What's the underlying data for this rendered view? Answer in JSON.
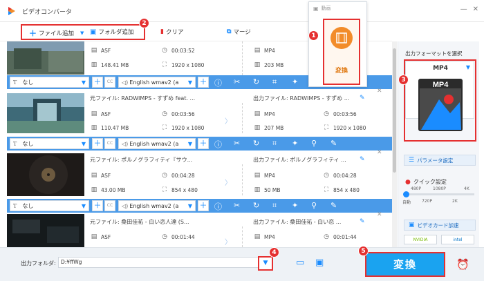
{
  "app": {
    "title": "ビデオコンバータ"
  },
  "toolbar": {
    "add_file": "ファイル追加",
    "add_folder": "フォルダ追加",
    "clear": "クリア",
    "merge": "マージ"
  },
  "popup": {
    "header": "動画",
    "label": "変換"
  },
  "rows": [
    {
      "source_title": "",
      "output_title": "",
      "src_format": "ASF",
      "src_duration": "00:03:52",
      "src_size": "148.41 MB",
      "src_res": "1920 x 1080",
      "out_format": "MP4",
      "out_duration": "",
      "out_size": "203 MB",
      "out_res": ""
    },
    {
      "source_title": "元ファイル: RADWIMPS - すずめ feat. ...",
      "output_title": "出力ファイル: RADWIMPS - すずめ ...",
      "src_format": "ASF",
      "src_duration": "00:03:56",
      "src_size": "110.47 MB",
      "src_res": "1920 x 1080",
      "out_format": "MP4",
      "out_duration": "00:03:56",
      "out_size": "207 MB",
      "out_res": "1920 x 1080"
    },
    {
      "source_title": "元ファイル: ポルノグラフィティ『サウ...",
      "output_title": "出力ファイル: ポルノグラフィティ ...",
      "src_format": "ASF",
      "src_duration": "00:04:28",
      "src_size": "43.00 MB",
      "src_res": "854 x 480",
      "out_format": "MP4",
      "out_duration": "00:04:28",
      "out_size": "50 MB",
      "out_res": "854 x 480"
    },
    {
      "source_title": "元ファイル: 桑田佳祐 - 白い恋人達 (S...",
      "output_title": "出力ファイル: 桑田佳祐 - 白い恋 ...",
      "src_format": "ASF",
      "src_duration": "00:01:44",
      "src_size": "",
      "src_res": "",
      "out_format": "MP4",
      "out_duration": "00:01:44",
      "out_size": "",
      "out_res": ""
    }
  ],
  "bars": [
    {
      "subtitle": "なし",
      "audio": "English wmav2 (a"
    },
    {
      "subtitle": "なし",
      "audio": "English wmav2 (a"
    },
    {
      "subtitle": "なし",
      "audio": "English wmav2 (a"
    }
  ],
  "sidebar": {
    "format_label": "出力フォーマットを選択",
    "format_name": "MP4",
    "format_icon_text": "MP4",
    "param_label": "パラメータ設定",
    "quick_label": "クイック設定",
    "ticks_top": [
      "480P",
      "1080P",
      "4K"
    ],
    "ticks_bottom": [
      "自動",
      "720P",
      "2K"
    ],
    "quality_level": 0,
    "gpu_label": "ビデオカード加速",
    "vendors": [
      "NVIDIA",
      "intel"
    ]
  },
  "bottom": {
    "output_label": "出力フォルダ:",
    "output_path": "D:¥ffWg",
    "convert_label": "変換"
  },
  "badges": [
    "1",
    "2",
    "3",
    "4",
    "5"
  ],
  "colors": {
    "accent": "#1a8cff",
    "highlight": "#e53030",
    "convert": "#1aa3f0",
    "popup": "#f28c2a"
  }
}
